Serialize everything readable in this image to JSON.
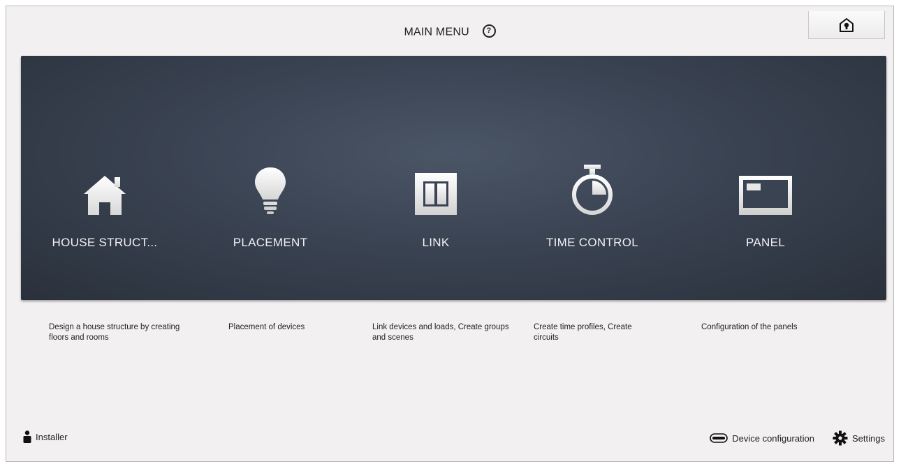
{
  "header": {
    "title": "MAIN MENU",
    "help_glyph": "?"
  },
  "tiles": [
    {
      "label": "HOUSE STRUCT...",
      "icon": "house-icon",
      "description": "Design a house structure by creating floors and rooms"
    },
    {
      "label": "PLACEMENT",
      "icon": "lightbulb-icon",
      "description": "Placement of devices"
    },
    {
      "label": "LINK",
      "icon": "switch-icon",
      "description": "Link devices and loads, Create groups and scenes"
    },
    {
      "label": "TIME CONTROL",
      "icon": "stopwatch-icon",
      "description": "Create time profiles, Create circuits"
    },
    {
      "label": "PANEL",
      "icon": "panel-icon",
      "description": "Configuration of the panels"
    }
  ],
  "footer": {
    "user_label": "Installer",
    "device_config_label": "Device configuration",
    "settings_label": "Settings"
  },
  "colors": {
    "panel_bg": "#343c49",
    "tile_text": "#f2f2f2",
    "page_bg": "#f2f0f0"
  }
}
